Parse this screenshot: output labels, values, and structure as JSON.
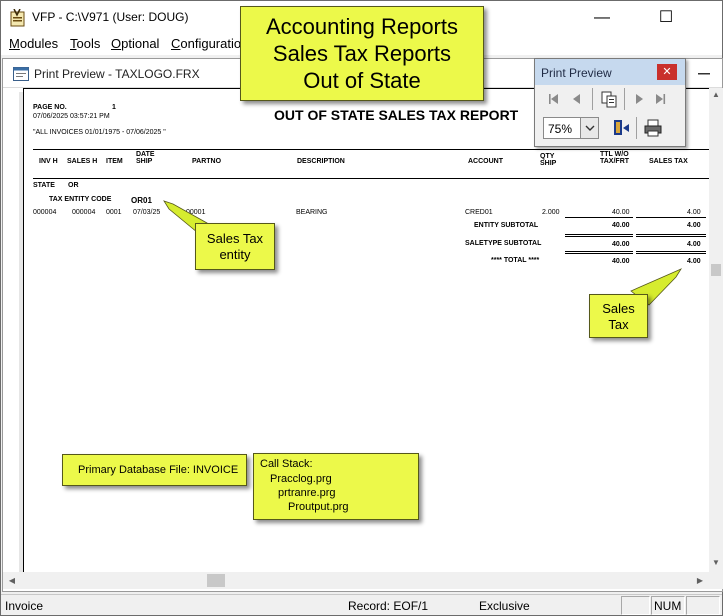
{
  "window": {
    "title": "VFP - C:\\V971  (User: DOUG)",
    "min_glyph": "—",
    "max_glyph": "☐"
  },
  "menu": {
    "items": [
      {
        "first": "M",
        "rest": "odules"
      },
      {
        "first": "T",
        "rest": "ools"
      },
      {
        "first": "O",
        "rest": "ptional"
      },
      {
        "first": "C",
        "rest": "onfiguration"
      }
    ]
  },
  "preview_window": {
    "title": "Print Preview - TAXLOGO.FRX"
  },
  "report": {
    "page_label": "PAGE NO.",
    "page_number": "1",
    "datetime": "07/06/2025 03:57:21 PM",
    "filter": "\"ALL INVOICES 01/01/1975 - 07/06/2025 \"",
    "title": "OUT OF STATE SALES TAX REPORT",
    "columns": {
      "invoice": "INV H",
      "sales": "SALES H",
      "item": "ITEM",
      "date_ship_1": "DATE",
      "date_ship_2": "SHIP",
      "partno": "PARTNO",
      "description": "DESCRIPTION",
      "account": "ACCOUNT",
      "qty_1": "QTY",
      "qty_2": "SHIP",
      "ttl_1": "TTL W/O",
      "ttl_2": "TAX/FRT",
      "sales_tax": "SALES TAX"
    },
    "state_label": "STATE",
    "state_value": "OR",
    "entity_label": "TAX ENTITY CODE",
    "entity_value": "OR01",
    "row": {
      "invoice": "000004",
      "sales": "000004",
      "item": "0001",
      "date": "07/03/25",
      "partno": "00001",
      "description": "BEARING",
      "account": "CRED01",
      "qty": "2.000",
      "total": "40.00",
      "tax": "4.00"
    },
    "entity_subtotal_label": "ENTITY SUBTOTAL",
    "entity_subtotal": "40.00",
    "entity_subtotal_tax": "4.00",
    "saletype_subtotal_label": "SALETYPE SUBTOTAL",
    "saletype_subtotal": "40.00",
    "saletype_subtotal_tax": "4.00",
    "grand_total_label": "**** TOTAL ****",
    "grand_total": "40.00",
    "grand_total_tax": "4.00"
  },
  "toolbar": {
    "title": "Print Preview",
    "close_glyph": "✕",
    "zoom": "75%"
  },
  "callouts": {
    "main": [
      "Accounting Reports",
      "Sales Tax Reports",
      "Out of State"
    ],
    "entity": [
      "Sales Tax",
      "entity"
    ],
    "tax": [
      "Sales",
      "Tax"
    ],
    "db_file": "Primary Database File: INVOICE",
    "call_stack": [
      "Call Stack:",
      "Pracclog.prg",
      "prtranre.prg",
      "Proutput.prg"
    ]
  },
  "status": {
    "left": "Invoice",
    "record": "Record: EOF/1",
    "mode": "Exclusive",
    "num": "NUM"
  },
  "colors": {
    "callout_fill": "#ecf94a",
    "arrow": "#d6ec2f",
    "toolbar_title": "#c6d9ee",
    "close_red": "#c9302c"
  }
}
